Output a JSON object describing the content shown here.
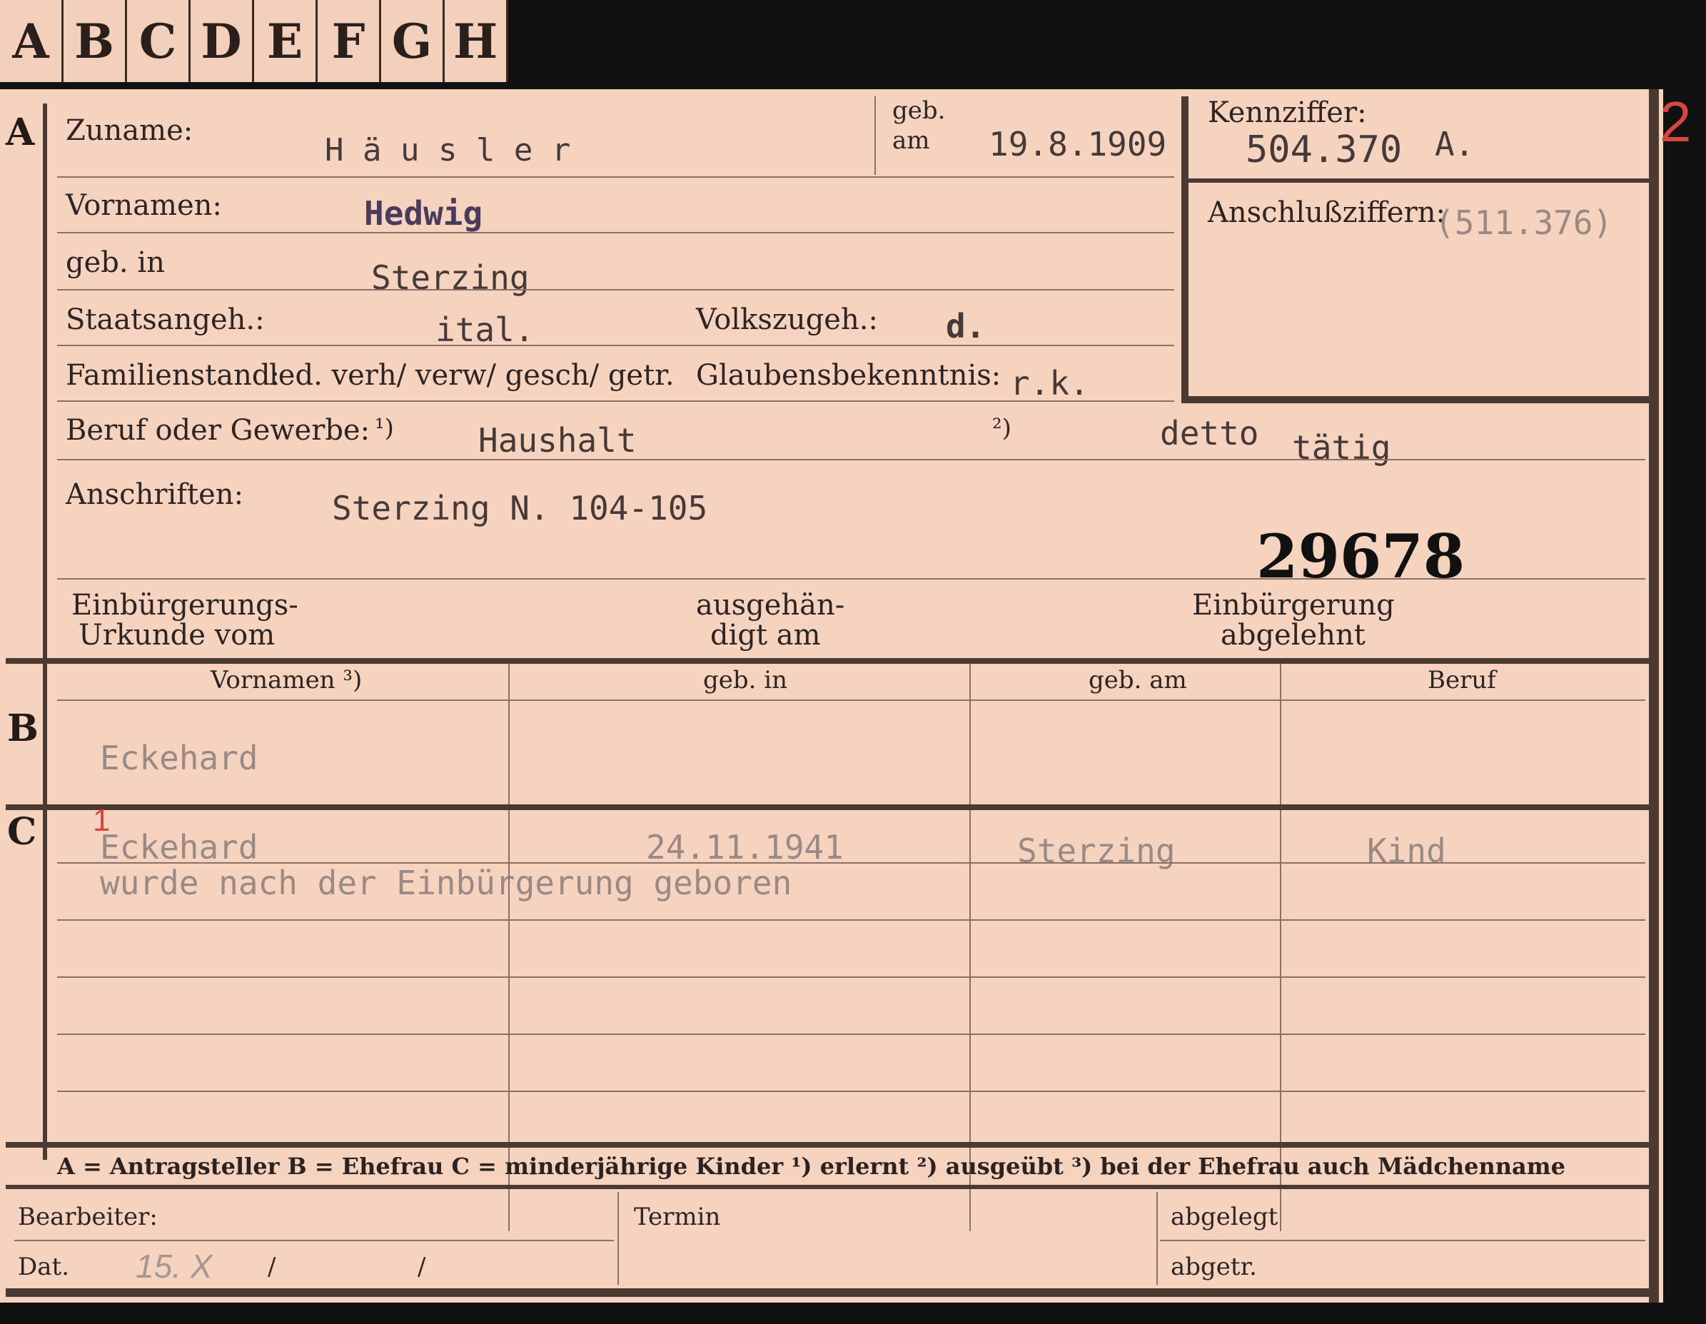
{
  "tabs": [
    "A",
    "B",
    "C",
    "D",
    "E",
    "F",
    "G",
    "H"
  ],
  "section_a": {
    "letter": "A",
    "surname_label": "Zuname:",
    "surname_value": "H ä u s l e r",
    "dob_label_1": "geb.",
    "dob_label_2": "am",
    "dob_value": "19.8.1909",
    "kennziffer_label": "Kennziffer:",
    "kennziffer_value": "504.370",
    "kennziffer_suffix": "A.",
    "sheet_number": "2",
    "anschluss_label": "Anschlußziffern:",
    "anschluss_value": "(511.376)",
    "first_names_label": "Vornamen:",
    "first_names_value": "Hedwig",
    "birthplace_label": "geb. in",
    "birthplace_value": "Sterzing",
    "citizenship_label": "Staatsangeh.:",
    "citizenship_value": "ital.",
    "ethnicity_label": "Volkszugeh.:",
    "ethnicity_value": "d.",
    "marital_label": "Familienstand:",
    "marital_value": "led. verh/ verw/ gesch/ getr.",
    "religion_label": "Glaubensbekenntnis:",
    "religion_value": "r.k.",
    "occupation_label": "Beruf oder Gewerbe:",
    "occupation_note1": "¹)",
    "occupation_value1": "Haushalt",
    "occupation_note2": "²)",
    "occupation_value2": "detto",
    "occupation_value2b": "tätig",
    "address_label": "Anschriften:",
    "address_value": "Sterzing N. 104-105",
    "stamp_number": "29678",
    "naturalization_label_1": "Einbürgerungs-",
    "naturalization_label_2": "Urkunde vom",
    "handed_label_1": "ausgehän-",
    "handed_label_2": "digt am",
    "rejected_label_1": "Einbürgerung",
    "rejected_label_2": "abgelehnt"
  },
  "section_b": {
    "letter": "B",
    "columns": [
      "Vornamen ³)",
      "geb. in",
      "geb. am",
      "Beruf"
    ],
    "row_name": "Eckehard"
  },
  "section_c": {
    "letter": "C",
    "mark": "1",
    "child_name": "Eckehard",
    "child_date": "24.11.1941",
    "child_place": "Sterzing",
    "child_occupation": "Kind",
    "child_note": "wurde nach der Einbürgerung geboren"
  },
  "legend": {
    "text": "A = Antragsteller    B = Ehefrau    C = minderjährige Kinder    ¹) erlernt    ²) ausgeübt    ³) bei der Ehefrau auch Mädchenname"
  },
  "bottom": {
    "clerk_label": "Bearbeiter:",
    "date_label": "Dat.",
    "date_value": "15. X",
    "date_slash1": "/",
    "date_slash2": "/",
    "deadline_label": "Termin",
    "filed_label": "abgelegt",
    "taken_label": "abgetr."
  }
}
